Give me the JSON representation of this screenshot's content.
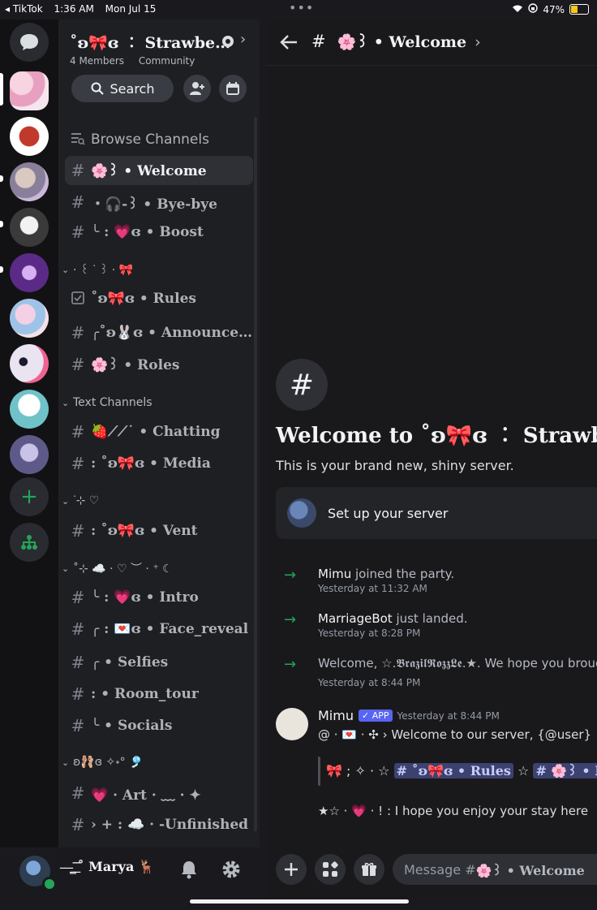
{
  "status_bar": {
    "back_app": "◂ TikTok",
    "time": "1:36 AM",
    "date": "Mon Jul 15",
    "battery": "47%",
    "battery_level": 0.47
  },
  "server": {
    "name": "˚ʚ🎀ɞ ︰ Strawberries",
    "members": "4 Members",
    "type": "Community",
    "search_label": "Search"
  },
  "channels": {
    "browse": "Browse Channels",
    "top": [
      {
        "name": "🌸꒱ • Welcome"
      },
      {
        "name": "・🎧‑꒱ • Bye-bye"
      },
      {
        "name": "╰ : 💗ɞ • Boost"
      }
    ],
    "cat1": {
      "label": "· ꒰ ᐝ ꒱ · 🎀"
    },
    "cat1_items": [
      {
        "name": "˚ʚ🎀ɞ • Rules"
      },
      {
        "name": "╭˚ʚ🐰ɞ • Announcements"
      },
      {
        "name": "🌸꒱ • Roles"
      }
    ],
    "cat2": {
      "label": "Text Channels"
    },
    "cat2_items": [
      {
        "name": "🍓⟋⟋˙ • Chatting"
      },
      {
        "name": ": ˚ʚ🎀ɞ • Media"
      }
    ],
    "cat3": {
      "label": "ᐝ⊹ ♡"
    },
    "cat3_items": [
      {
        "name": ": ˚ʚ🎀ɞ • Vent"
      }
    ],
    "cat4": {
      "label": "˚⊹ ☁️ · ♡ ︶ · ⁺ ☾"
    },
    "cat4_items": [
      {
        "name": "╰ : 💗ɞ • Intro"
      },
      {
        "name": "╭ : 💌ɞ • Face_reveal"
      },
      {
        "name": "╭ • Selfies"
      },
      {
        "name": ": • Room_tour"
      },
      {
        "name": "╰ • Socials"
      }
    ],
    "cat5": {
      "label": "ʚ🩰ɞ ✧˖° 🎐"
    },
    "cat5_items": [
      {
        "name": "💗 · Art · ﹏ · ✦"
      },
      {
        "name": "› + : ☁️ · -Unfinished"
      }
    ]
  },
  "user": {
    "name": "—̳͟͞͞ ˚ Marya 🦌"
  },
  "main": {
    "channel_title": "🌸꒱ • Welcome",
    "welcome_title": "Welcome to ˚ʚ🎀ɞ ︰ Strawberries",
    "welcome_sub": "This is your brand new, shiny server.",
    "setup_label": "Set up your server",
    "sys": [
      {
        "user": "Mimu",
        "text": " joined the party.",
        "ts": "Yesterday at 11:32 AM"
      },
      {
        "user": "MarriageBot",
        "text": " just landed.",
        "ts": "Yesterday at 8:28 PM"
      },
      {
        "user": "",
        "text": "Welcome, ☆.𝕭𝖗𝖆𝖟𝖎𝖑𝕽𝖔𝖟𝖟𝕷𝖊.★. We hope you brought pizza.",
        "ts": "Yesterday at 8:44 PM"
      }
    ],
    "bot": {
      "name": "Mimu",
      "tag": "✓ APP",
      "ts": "Yesterday at 8:44 PM",
      "line": "@ · 💌 · ✣ › Welcome to our server, {@user}",
      "quote_prefix": "🎀 ; ✧ · ☆",
      "mention1": "# ˚ʚ🎀ɞ • Rules",
      "mention_sep": "☆",
      "mention2": "# 🌸꒱ • Roles",
      "tail": "★☆ · 💗 · ! : I hope you enjoy your stay here"
    },
    "composer_prefix": "Message #",
    "composer_channel": "🌸꒱ • Welcome"
  }
}
